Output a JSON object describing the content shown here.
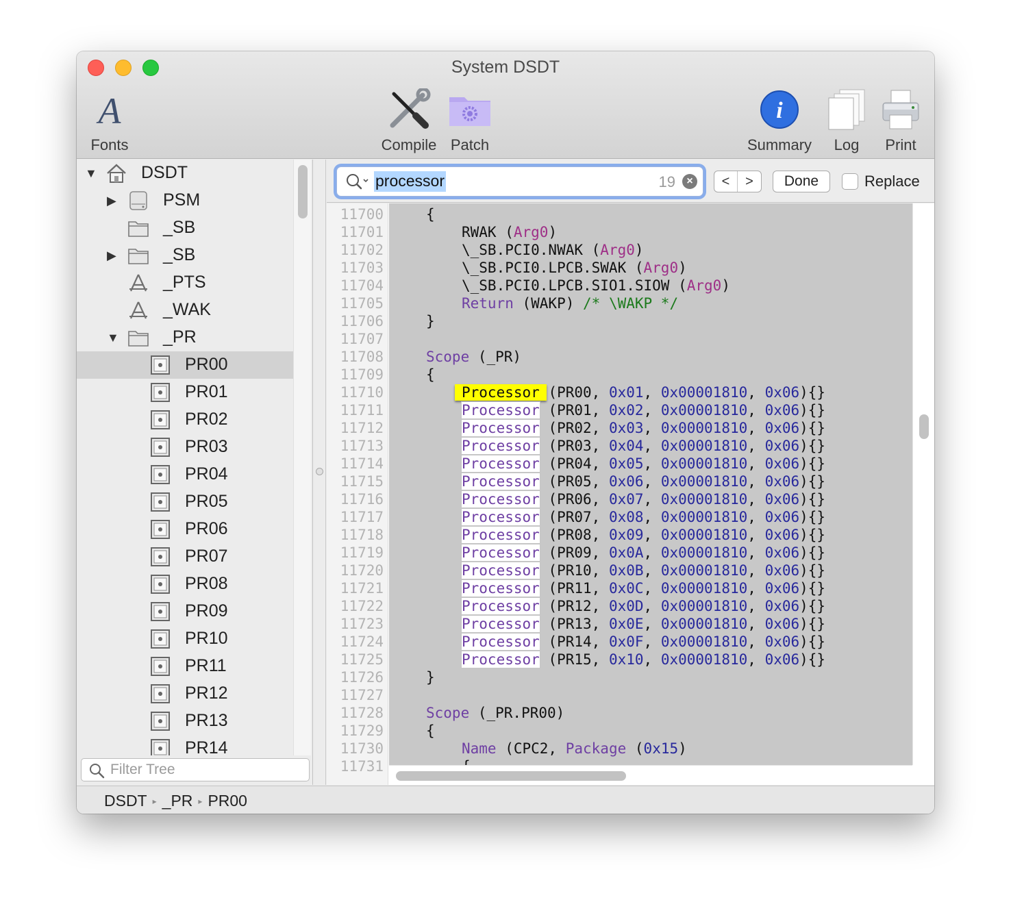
{
  "window": {
    "title": "System DSDT"
  },
  "toolbar": {
    "fonts_label": "Fonts",
    "compile_label": "Compile",
    "patch_label": "Patch",
    "summary_label": "Summary",
    "log_label": "Log",
    "print_label": "Print"
  },
  "tree": {
    "nodes": [
      {
        "label": "DSDT",
        "icon": "home-icon",
        "expanded": true
      },
      {
        "label": "PSM",
        "icon": "drive-icon",
        "expanded": false
      },
      {
        "label": "_SB",
        "icon": "folder-icon"
      },
      {
        "label": "_SB",
        "icon": "folder-icon",
        "expanded": false
      },
      {
        "label": "_PTS",
        "icon": "method-icon"
      },
      {
        "label": "_WAK",
        "icon": "method-icon"
      },
      {
        "label": "_PR",
        "icon": "folder-icon",
        "expanded": true
      },
      {
        "label": "PR00",
        "icon": "processor-icon",
        "selected": true
      },
      {
        "label": "PR01",
        "icon": "processor-icon"
      },
      {
        "label": "PR02",
        "icon": "processor-icon"
      },
      {
        "label": "PR03",
        "icon": "processor-icon"
      },
      {
        "label": "PR04",
        "icon": "processor-icon"
      },
      {
        "label": "PR05",
        "icon": "processor-icon"
      },
      {
        "label": "PR06",
        "icon": "processor-icon"
      },
      {
        "label": "PR07",
        "icon": "processor-icon"
      },
      {
        "label": "PR08",
        "icon": "processor-icon"
      },
      {
        "label": "PR09",
        "icon": "processor-icon"
      },
      {
        "label": "PR10",
        "icon": "processor-icon"
      },
      {
        "label": "PR11",
        "icon": "processor-icon"
      },
      {
        "label": "PR12",
        "icon": "processor-icon"
      },
      {
        "label": "PR13",
        "icon": "processor-icon"
      },
      {
        "label": "PR14",
        "icon": "processor-icon"
      }
    ],
    "filter_placeholder": "Filter Tree"
  },
  "find": {
    "query": "processor",
    "match_count": "19",
    "prev_symbol": "<",
    "next_symbol": ">",
    "done_label": "Done",
    "replace_label": "Replace",
    "replace_checked": false
  },
  "editor": {
    "line_numbers": [
      "11700",
      "11701",
      "11702",
      "11703",
      "11704",
      "11705",
      "11706",
      "11707",
      "11708",
      "11709",
      "11710",
      "11711",
      "11712",
      "11713",
      "11714",
      "11715",
      "11716",
      "11717",
      "11718",
      "11719",
      "11720",
      "11721",
      "11722",
      "11723",
      "11724",
      "11725",
      "11726",
      "11727",
      "11728",
      "11729",
      "11730",
      "11731"
    ],
    "lines": [
      {
        "indent": 1,
        "tokens": [
          [
            "{",
            ""
          ]
        ]
      },
      {
        "indent": 2,
        "tokens": [
          [
            "RWAK (",
            ""
          ],
          [
            "Arg0",
            "arg"
          ],
          [
            ")",
            ""
          ]
        ]
      },
      {
        "indent": 2,
        "tokens": [
          [
            "\\_SB.PCI0.NWAK (",
            ""
          ],
          [
            "Arg0",
            "arg"
          ],
          [
            ")",
            ""
          ]
        ]
      },
      {
        "indent": 2,
        "tokens": [
          [
            "\\_SB.PCI0.LPCB.SWAK (",
            ""
          ],
          [
            "Arg0",
            "arg"
          ],
          [
            ")",
            ""
          ]
        ]
      },
      {
        "indent": 2,
        "tokens": [
          [
            "\\_SB.PCI0.LPCB.SIO1.SIOW (",
            ""
          ],
          [
            "Arg0",
            "arg"
          ],
          [
            ")",
            ""
          ]
        ]
      },
      {
        "indent": 2,
        "tokens": [
          [
            "Return",
            "kw"
          ],
          [
            " (WAKP) ",
            ""
          ],
          [
            "/* \\WAKP */",
            "cmt"
          ]
        ]
      },
      {
        "indent": 1,
        "tokens": [
          [
            "}",
            ""
          ]
        ]
      },
      {
        "indent": 0,
        "tokens": []
      },
      {
        "indent": 1,
        "tokens": [
          [
            "Scope",
            "kw"
          ],
          [
            " (_PR)",
            ""
          ]
        ]
      },
      {
        "indent": 1,
        "tokens": [
          [
            "{",
            ""
          ]
        ]
      },
      {
        "indent": 2,
        "tokens": [
          [
            "Processor",
            "hl-cur"
          ],
          [
            " (PR00, ",
            ""
          ],
          [
            "0x01",
            "num"
          ],
          [
            ", ",
            ""
          ],
          [
            "0x00001810",
            "num"
          ],
          [
            ", ",
            ""
          ],
          [
            "0x06",
            "num"
          ],
          [
            "){}",
            ""
          ]
        ]
      },
      {
        "indent": 2,
        "tokens": [
          [
            "Processor",
            "hl"
          ],
          [
            " (PR01, ",
            ""
          ],
          [
            "0x02",
            "num"
          ],
          [
            ", ",
            ""
          ],
          [
            "0x00001810",
            "num"
          ],
          [
            ", ",
            ""
          ],
          [
            "0x06",
            "num"
          ],
          [
            "){}",
            ""
          ]
        ]
      },
      {
        "indent": 2,
        "tokens": [
          [
            "Processor",
            "hl"
          ],
          [
            " (PR02, ",
            ""
          ],
          [
            "0x03",
            "num"
          ],
          [
            ", ",
            ""
          ],
          [
            "0x00001810",
            "num"
          ],
          [
            ", ",
            ""
          ],
          [
            "0x06",
            "num"
          ],
          [
            "){}",
            ""
          ]
        ]
      },
      {
        "indent": 2,
        "tokens": [
          [
            "Processor",
            "hl"
          ],
          [
            " (PR03, ",
            ""
          ],
          [
            "0x04",
            "num"
          ],
          [
            ", ",
            ""
          ],
          [
            "0x00001810",
            "num"
          ],
          [
            ", ",
            ""
          ],
          [
            "0x06",
            "num"
          ],
          [
            "){}",
            ""
          ]
        ]
      },
      {
        "indent": 2,
        "tokens": [
          [
            "Processor",
            "hl"
          ],
          [
            " (PR04, ",
            ""
          ],
          [
            "0x05",
            "num"
          ],
          [
            ", ",
            ""
          ],
          [
            "0x00001810",
            "num"
          ],
          [
            ", ",
            ""
          ],
          [
            "0x06",
            "num"
          ],
          [
            "){}",
            ""
          ]
        ]
      },
      {
        "indent": 2,
        "tokens": [
          [
            "Processor",
            "hl"
          ],
          [
            " (PR05, ",
            ""
          ],
          [
            "0x06",
            "num"
          ],
          [
            ", ",
            ""
          ],
          [
            "0x00001810",
            "num"
          ],
          [
            ", ",
            ""
          ],
          [
            "0x06",
            "num"
          ],
          [
            "){}",
            ""
          ]
        ]
      },
      {
        "indent": 2,
        "tokens": [
          [
            "Processor",
            "hl"
          ],
          [
            " (PR06, ",
            ""
          ],
          [
            "0x07",
            "num"
          ],
          [
            ", ",
            ""
          ],
          [
            "0x00001810",
            "num"
          ],
          [
            ", ",
            ""
          ],
          [
            "0x06",
            "num"
          ],
          [
            "){}",
            ""
          ]
        ]
      },
      {
        "indent": 2,
        "tokens": [
          [
            "Processor",
            "hl"
          ],
          [
            " (PR07, ",
            ""
          ],
          [
            "0x08",
            "num"
          ],
          [
            ", ",
            ""
          ],
          [
            "0x00001810",
            "num"
          ],
          [
            ", ",
            ""
          ],
          [
            "0x06",
            "num"
          ],
          [
            "){}",
            ""
          ]
        ]
      },
      {
        "indent": 2,
        "tokens": [
          [
            "Processor",
            "hl"
          ],
          [
            " (PR08, ",
            ""
          ],
          [
            "0x09",
            "num"
          ],
          [
            ", ",
            ""
          ],
          [
            "0x00001810",
            "num"
          ],
          [
            ", ",
            ""
          ],
          [
            "0x06",
            "num"
          ],
          [
            "){}",
            ""
          ]
        ]
      },
      {
        "indent": 2,
        "tokens": [
          [
            "Processor",
            "hl"
          ],
          [
            " (PR09, ",
            ""
          ],
          [
            "0x0A",
            "num"
          ],
          [
            ", ",
            ""
          ],
          [
            "0x00001810",
            "num"
          ],
          [
            ", ",
            ""
          ],
          [
            "0x06",
            "num"
          ],
          [
            "){}",
            ""
          ]
        ]
      },
      {
        "indent": 2,
        "tokens": [
          [
            "Processor",
            "hl"
          ],
          [
            " (PR10, ",
            ""
          ],
          [
            "0x0B",
            "num"
          ],
          [
            ", ",
            ""
          ],
          [
            "0x00001810",
            "num"
          ],
          [
            ", ",
            ""
          ],
          [
            "0x06",
            "num"
          ],
          [
            "){}",
            ""
          ]
        ]
      },
      {
        "indent": 2,
        "tokens": [
          [
            "Processor",
            "hl"
          ],
          [
            " (PR11, ",
            ""
          ],
          [
            "0x0C",
            "num"
          ],
          [
            ", ",
            ""
          ],
          [
            "0x00001810",
            "num"
          ],
          [
            ", ",
            ""
          ],
          [
            "0x06",
            "num"
          ],
          [
            "){}",
            ""
          ]
        ]
      },
      {
        "indent": 2,
        "tokens": [
          [
            "Processor",
            "hl"
          ],
          [
            " (PR12, ",
            ""
          ],
          [
            "0x0D",
            "num"
          ],
          [
            ", ",
            ""
          ],
          [
            "0x00001810",
            "num"
          ],
          [
            ", ",
            ""
          ],
          [
            "0x06",
            "num"
          ],
          [
            "){}",
            ""
          ]
        ]
      },
      {
        "indent": 2,
        "tokens": [
          [
            "Processor",
            "hl"
          ],
          [
            " (PR13, ",
            ""
          ],
          [
            "0x0E",
            "num"
          ],
          [
            ", ",
            ""
          ],
          [
            "0x00001810",
            "num"
          ],
          [
            ", ",
            ""
          ],
          [
            "0x06",
            "num"
          ],
          [
            "){}",
            ""
          ]
        ]
      },
      {
        "indent": 2,
        "tokens": [
          [
            "Processor",
            "hl"
          ],
          [
            " (PR14, ",
            ""
          ],
          [
            "0x0F",
            "num"
          ],
          [
            ", ",
            ""
          ],
          [
            "0x00001810",
            "num"
          ],
          [
            ", ",
            ""
          ],
          [
            "0x06",
            "num"
          ],
          [
            "){}",
            ""
          ]
        ]
      },
      {
        "indent": 2,
        "tokens": [
          [
            "Processor",
            "hl"
          ],
          [
            " (PR15, ",
            ""
          ],
          [
            "0x10",
            "num"
          ],
          [
            ", ",
            ""
          ],
          [
            "0x00001810",
            "num"
          ],
          [
            ", ",
            ""
          ],
          [
            "0x06",
            "num"
          ],
          [
            "){}",
            ""
          ]
        ]
      },
      {
        "indent": 1,
        "tokens": [
          [
            "}",
            ""
          ]
        ]
      },
      {
        "indent": 0,
        "tokens": []
      },
      {
        "indent": 1,
        "tokens": [
          [
            "Scope",
            "kw"
          ],
          [
            " (_PR.PR00)",
            ""
          ]
        ]
      },
      {
        "indent": 1,
        "tokens": [
          [
            "{",
            ""
          ]
        ]
      },
      {
        "indent": 2,
        "tokens": [
          [
            "Name",
            "kw"
          ],
          [
            " (CPC2, ",
            ""
          ],
          [
            "Package",
            "kw"
          ],
          [
            " (",
            ""
          ],
          [
            "0x15",
            "num"
          ],
          [
            ")",
            ""
          ]
        ]
      },
      {
        "indent": 2,
        "tokens": [
          [
            "{",
            ""
          ]
        ]
      }
    ]
  },
  "breadcrumb": {
    "items": [
      "DSDT",
      "_PR",
      "PR00"
    ]
  }
}
